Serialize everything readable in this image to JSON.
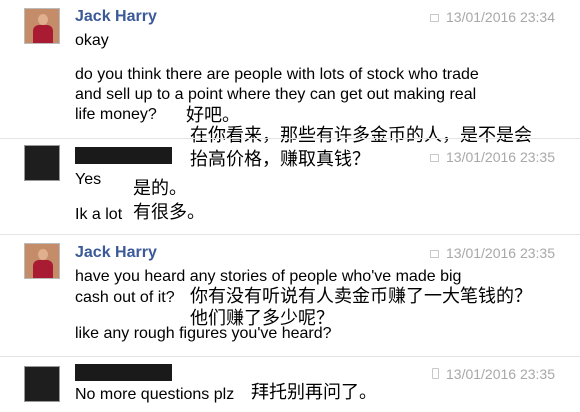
{
  "messages": [
    {
      "sender": "Jack Harry",
      "timestamp": "13/01/2016 23:34",
      "lines": [
        "okay",
        "do you think there are people with lots of stock who trade",
        "and sell up to a point where they can get out making real",
        "life money?"
      ]
    },
    {
      "sender": "",
      "timestamp": "13/01/2016 23:35",
      "lines": [
        "Yes",
        "Ik a lot"
      ]
    },
    {
      "sender": "Jack Harry",
      "timestamp": "13/01/2016 23:35",
      "lines": [
        "have you heard any stories of people who've made big",
        "cash out of it?",
        "like any rough figures you've heard?"
      ]
    },
    {
      "sender": "",
      "timestamp": "13/01/2016 23:35",
      "lines": [
        "No more questions plz"
      ]
    }
  ],
  "translations": [
    "好吧。",
    "在你看来，那些有许多金币的人，是不是会",
    "抬高价格，赚取真钱？",
    "是的。",
    "有很多。",
    "你有没有听说有人卖金币赚了一大笔钱的？",
    "他们赚了多少呢？",
    "拜托别再问了。"
  ],
  "colors": {
    "sender_name": "#3b5998",
    "timestamp": "#a8a8a8"
  }
}
